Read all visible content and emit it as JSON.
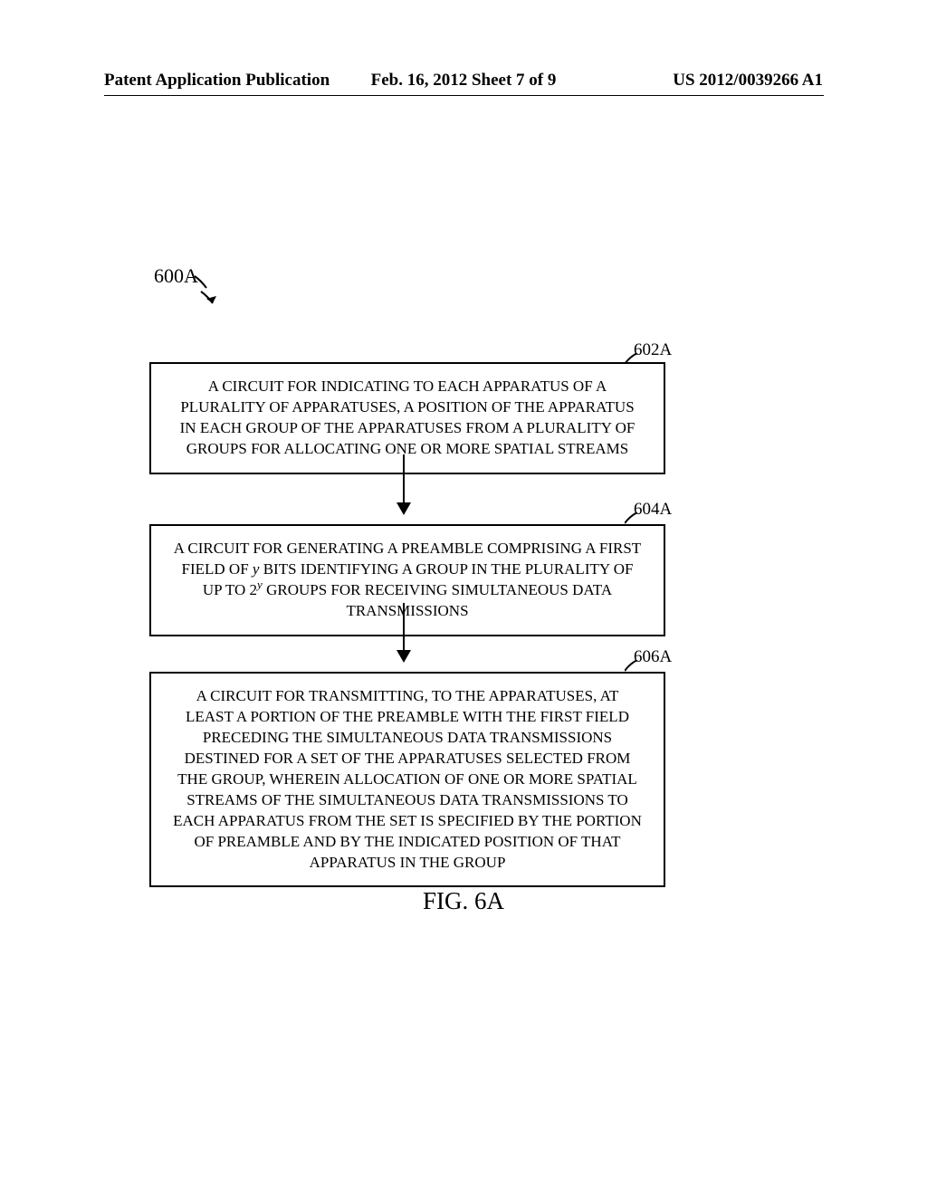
{
  "header": {
    "left": "Patent Application Publication",
    "center": "Feb. 16, 2012  Sheet 7 of 9",
    "right": "US 2012/0039266 A1"
  },
  "flowchart": {
    "label": "600A",
    "boxes": {
      "b602": {
        "label": "602A",
        "text": "A CIRCUIT FOR INDICATING TO EACH APPARATUS OF A PLURALITY OF APPARATUSES, A POSITION OF THE APPARATUS IN EACH GROUP OF THE APPARATUSES FROM A PLURALITY OF GROUPS FOR ALLOCATING ONE OR MORE SPATIAL STREAMS"
      },
      "b604": {
        "label": "604A",
        "text_pre": "A CIRCUIT FOR GENERATING A PREAMBLE COMPRISING A FIRST FIELD OF ",
        "text_y": "y",
        "text_mid": " BITS IDENTIFYING A GROUP IN THE PLURALITY OF UP TO 2",
        "text_sup": "y",
        "text_post": " GROUPS FOR RECEIVING SIMULTANEOUS DATA TRANSMISSIONS"
      },
      "b606": {
        "label": "606A",
        "text": "A CIRCUIT FOR TRANSMITTING, TO THE APPARATUSES, AT LEAST A PORTION OF THE PREAMBLE WITH THE FIRST FIELD PRECEDING THE SIMULTANEOUS DATA TRANSMISSIONS DESTINED FOR A SET OF THE APPARATUSES SELECTED FROM THE GROUP, WHEREIN ALLOCATION OF ONE OR MORE SPATIAL STREAMS OF THE SIMULTANEOUS DATA TRANSMISSIONS TO EACH APPARATUS FROM THE SET IS SPECIFIED BY THE PORTION OF PREAMBLE AND BY THE INDICATED POSITION OF THAT APPARATUS IN THE GROUP"
      }
    }
  },
  "figure_caption": "FIG. 6A"
}
